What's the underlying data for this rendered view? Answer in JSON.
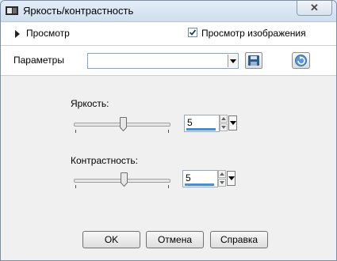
{
  "window": {
    "title": "Яркость/контрастность"
  },
  "preview": {
    "label": "Просмотр",
    "image_preview_label": "Просмотр изображения",
    "image_preview_checked": true
  },
  "params": {
    "label": "Параметры",
    "preset_value": ""
  },
  "brightness": {
    "label": "Яркость:",
    "value": "5"
  },
  "contrast": {
    "label": "Контрастность:",
    "value": "5"
  },
  "buttons": {
    "ok": "OK",
    "cancel": "Отмена",
    "help": "Справка"
  },
  "colors": {
    "accent": "#3d8fe0",
    "titlebar": "#d6e3f2",
    "window_bg": "#f0f0f0"
  }
}
